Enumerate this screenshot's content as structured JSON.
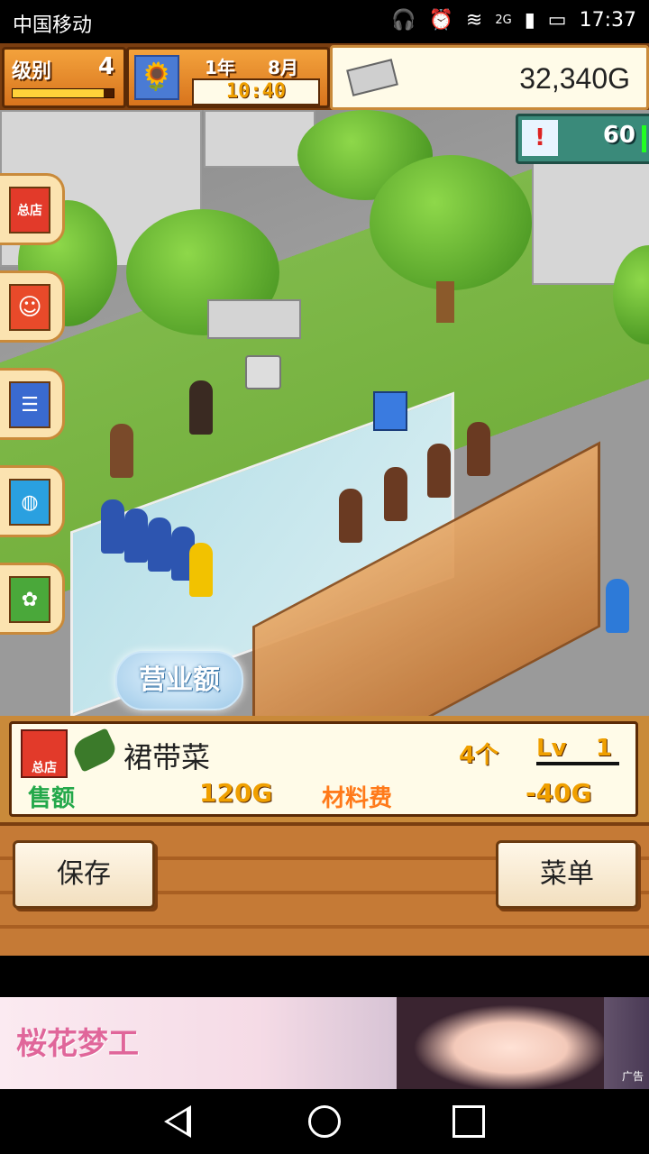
{
  "status_bar": {
    "carrier": "中国移动",
    "network": "2G",
    "time": "17:37"
  },
  "hud": {
    "level_label": "级别",
    "level_value": "4",
    "level_progress": 0.9,
    "year": "1年",
    "month": "8月",
    "clock": "10:40",
    "money": "32,340G",
    "alert_value": "60"
  },
  "side_menu": [
    {
      "label": "总店",
      "icon": "shop-icon"
    },
    {
      "label": "",
      "icon": "staff-icon"
    },
    {
      "label": "",
      "icon": "menu-board-icon"
    },
    {
      "label": "",
      "icon": "pot-icon"
    },
    {
      "label": "",
      "icon": "ingredients-icon"
    }
  ],
  "field": {
    "sales_bubble": "营业额"
  },
  "info": {
    "shop_label": "总店",
    "dish_name": "裙带菜",
    "count": "4个",
    "level_prefix": "Lv",
    "level": "1",
    "sell_label": "售额",
    "sell_value": "120G",
    "cost_label": "材料费",
    "cost_value": "-40G"
  },
  "footer": {
    "save_label": "保存",
    "menu_label": "菜单"
  },
  "ad": {
    "logo": "桜花梦工",
    "tag": "广告"
  },
  "colors": {
    "hud_orange": "#d8741d",
    "panel_cream": "#fffbe8",
    "sell_green": "#24a84a",
    "cost_orange": "#ff7a1a",
    "value_gold": "#f0a000"
  }
}
